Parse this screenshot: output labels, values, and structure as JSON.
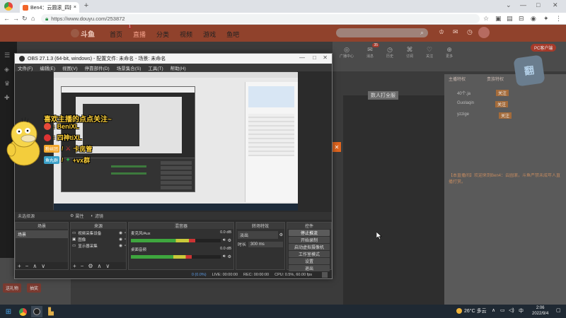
{
  "browser": {
    "tab_title": "Ben4：云圆滚_四排帮盟赛开",
    "url": "https://www.douyu.com/253872",
    "new_tab": "+"
  },
  "site": {
    "logo": "斗鱼",
    "nav": [
      "首页",
      "直播",
      "分类",
      "视频",
      "游戏",
      "鱼吧"
    ],
    "nav_badges": [
      "",
      "1",
      "",
      "",
      "",
      ""
    ],
    "search_placeholder": "",
    "pc_client": "PC客户端",
    "top_icons": [
      {
        "label": "广播中心",
        "badge": ""
      },
      {
        "label": "消息",
        "badge": "35"
      },
      {
        "label": "历史",
        "badge": ""
      },
      {
        "label": "订阅",
        "badge": ""
      },
      {
        "label": "关注",
        "badge": ""
      },
      {
        "label": "更多",
        "badge": ""
      }
    ],
    "stream_action": "数人打全服",
    "chat_tabs": [
      "主播特权",
      "贵族特权"
    ],
    "chat_messages": [
      {
        "user": "40个.ja",
        "badge": "关注"
      },
      {
        "user": "Guolaqin",
        "badge": "关注"
      },
      {
        "user": "yzzige",
        "badge": "关注"
      }
    ],
    "notice": "【本直播间】欢迎来到Ben4：云圆滚，斗鱼严禁未成年人直播打赏。",
    "left_buttons": [
      "送礼物",
      "抽奖"
    ]
  },
  "obs": {
    "title": "OBS 27.1.3 (64-bit, windows) - 配置文件: 未命名 - 场景: 未命名",
    "menu": [
      "文件(F)",
      "编辑(E)",
      "视图(V)",
      "停靠部件(D)",
      "场景集合(S)",
      "工具(T)",
      "帮助(H)"
    ],
    "docks": {
      "scenes": "场景",
      "sources": "来源",
      "mixer": "混音器",
      "transitions": "转场特效",
      "controls": "控件"
    },
    "no_source_selected": "未选择源",
    "props_button": "属性",
    "filters_button": "滤镜",
    "scene_items": [
      "场景"
    ],
    "source_items": [
      "视频采集设备",
      "图像",
      "显示器采集"
    ],
    "mixer_tracks": [
      {
        "name": "麦克风/Aux",
        "level": "0.0 dB",
        "fill": 0.72
      },
      {
        "name": "桌面音频",
        "level": "0.0 dB",
        "fill": 0.68
      }
    ],
    "transition_type": "淡出",
    "transition_duration_label": "时长",
    "transition_duration": "300 ms",
    "controls": [
      "停止推流",
      "开始录制",
      "启动虚拟摄像机",
      "工作室模式",
      "设置",
      "退出"
    ],
    "status": {
      "dropped": "0 (0.0%)",
      "live": "LIVE: 00:00:00",
      "rec": "REC: 00:00:00",
      "cpu": "CPU: 0.5%, 60.00 fps"
    }
  },
  "overlay": {
    "line1": "喜欢主播的点点关注~",
    "line2": "BeniXL",
    "line3": "四神tiXL",
    "line4_a": "粉丝团",
    "line4_b": "卡房管",
    "line5_a": "鱼丸群",
    "line5_b": "+vx群"
  },
  "taskbar": {
    "weather": "26°C 多云",
    "time": "2:06",
    "date": "2022/9/4"
  }
}
